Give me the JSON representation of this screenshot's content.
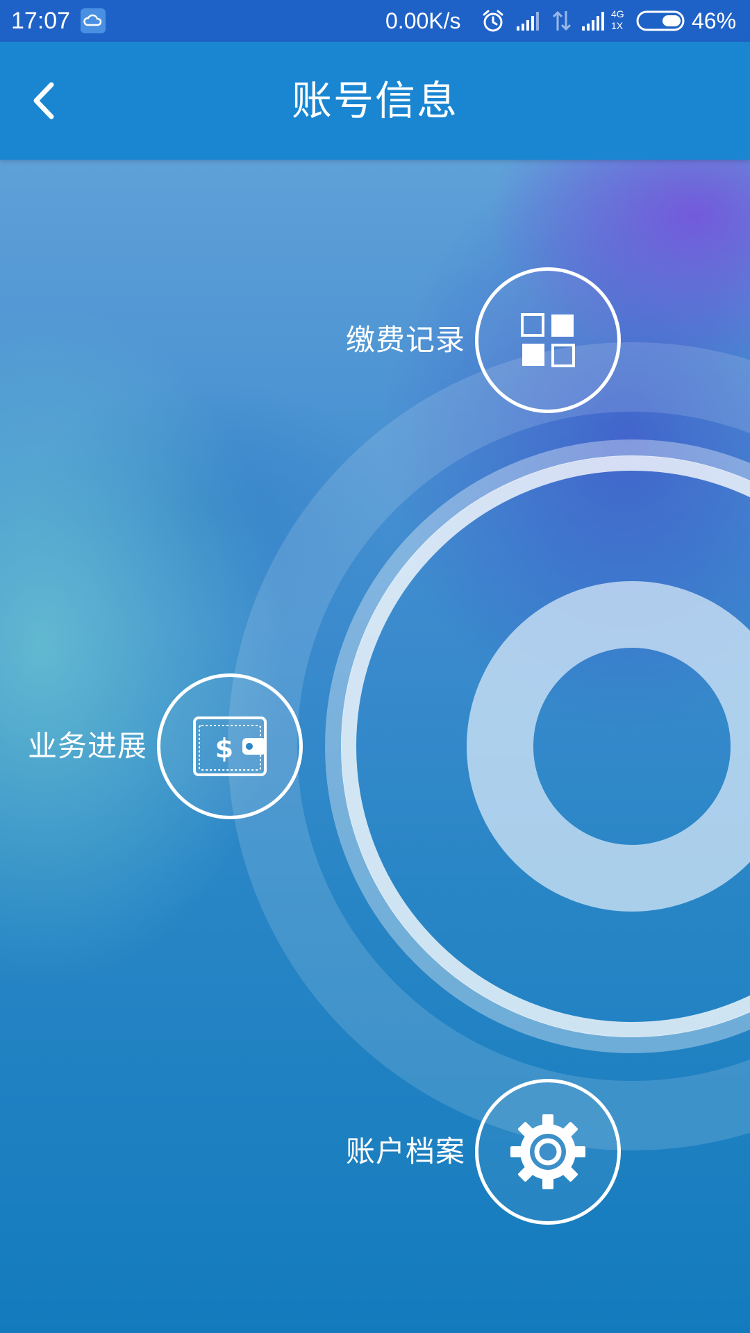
{
  "status_bar": {
    "time": "17:07",
    "net_speed": "0.00K/s",
    "network_label_top": "4G",
    "network_label_bottom": "1X",
    "battery_percent": "46%",
    "icons": [
      "cloud-icon",
      "alarm-icon",
      "signal-icon",
      "data-arrows-icon",
      "signal-icon",
      "battery-icon"
    ]
  },
  "header": {
    "title": "账号信息",
    "back_icon": "chevron-left-icon"
  },
  "menu": {
    "payment_records": {
      "label": "缴费记录",
      "icon": "grid-icon"
    },
    "business_progress": {
      "label": "业务进展",
      "icon": "wallet-icon"
    },
    "account_profile": {
      "label": "账户档案",
      "icon": "gear-icon"
    }
  },
  "colors": {
    "status_bar": "#1f62c7",
    "app_bar": "#1a86d2",
    "text": "#ffffff"
  }
}
